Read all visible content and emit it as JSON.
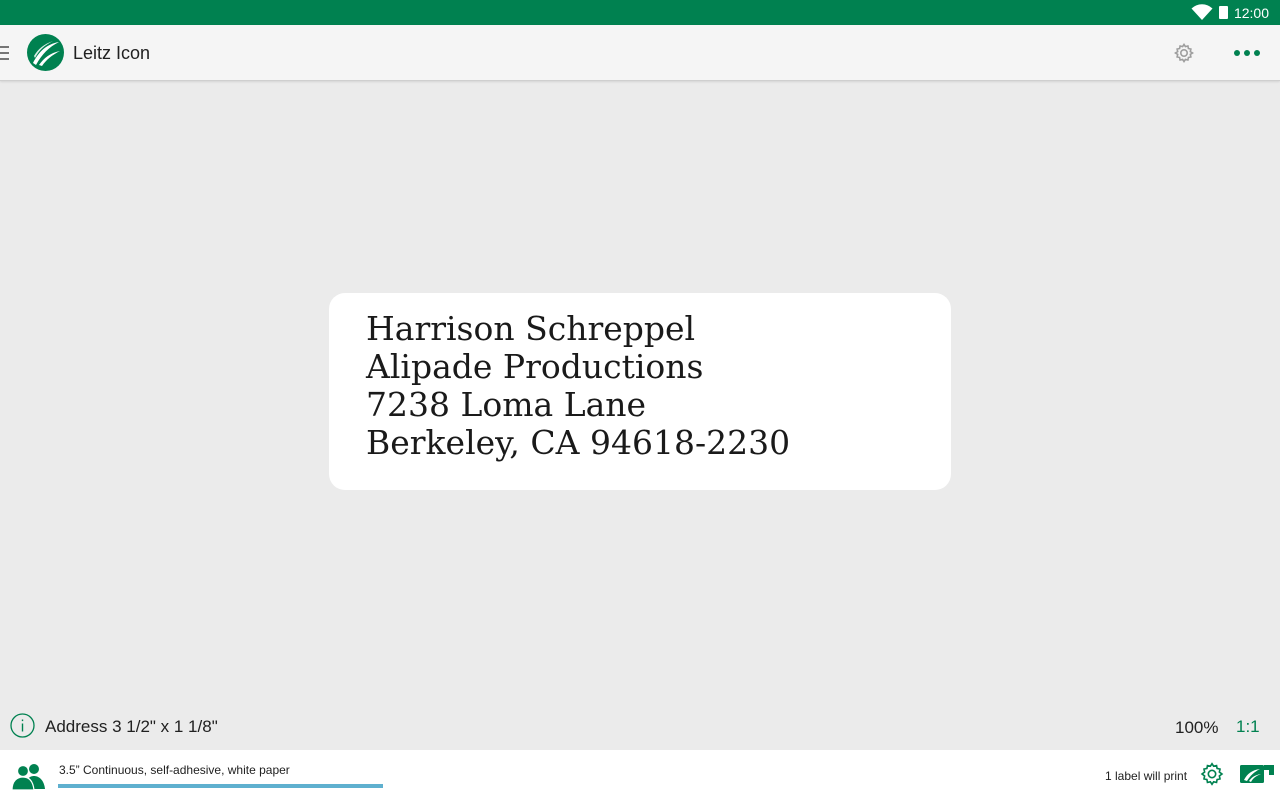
{
  "status_bar": {
    "time": "12:00",
    "icons": [
      "wifi-icon",
      "battery-icon"
    ]
  },
  "toolbar": {
    "app_title": "Leitz Icon",
    "icons": [
      "menu-icon",
      "leitz-logo",
      "gear-icon",
      "more-icon"
    ]
  },
  "label": {
    "lines": [
      "Harrison Schreppel",
      "Alipade Productions",
      "7238 Loma Lane",
      "Berkeley, CA 94618-2230"
    ]
  },
  "info_bar": {
    "template_name": "Address 3 1/2\" x 1 1/8\"",
    "zoom": "100%",
    "ratio": "1:1",
    "icons": [
      "info-icon"
    ]
  },
  "bottom_bar": {
    "media": "3.5” Continuous, self-adhesive, white paper",
    "media_fill_fraction": 1.0,
    "print_status": "1 label will print",
    "icons": [
      "contacts-icon",
      "gear-icon",
      "print-icon"
    ]
  },
  "colors": {
    "brand_green": "#008150",
    "canvas_background": "#ebebeb",
    "media_bar": "#5fb0cf"
  }
}
